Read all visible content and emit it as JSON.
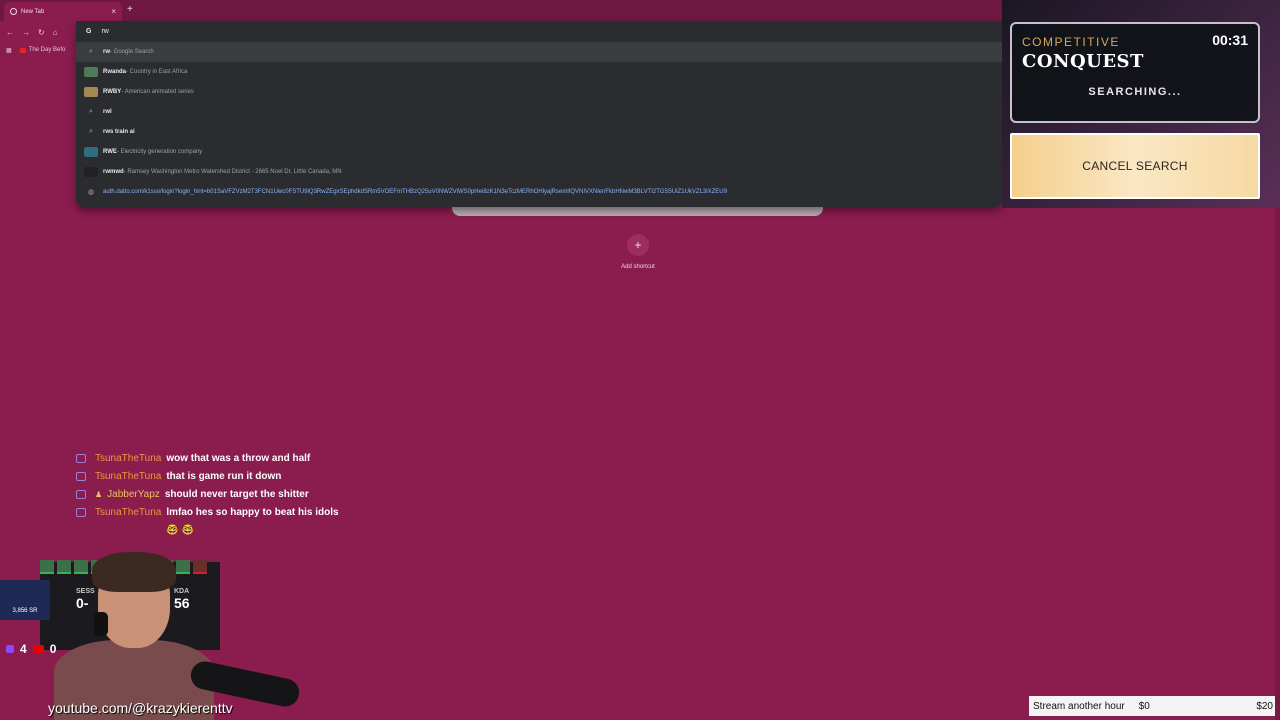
{
  "browser": {
    "tab_title": "New Tab",
    "new_tab_symbol": "+",
    "close_symbol": "×",
    "bookmark_label": "The Day Befo"
  },
  "omnibox": {
    "query": "rw",
    "suggestions": [
      {
        "type": "search",
        "bold": "rw",
        "sub": " - Google Search",
        "selected": true
      },
      {
        "type": "entity",
        "bold": "Rwanda",
        "sub": " - Country in East Africa",
        "thumb": "#4f7a5a"
      },
      {
        "type": "entity",
        "bold": "RWBY",
        "sub": " - American animated series",
        "thumb": "#a58752"
      },
      {
        "type": "search",
        "bold": "rwl",
        "sub": ""
      },
      {
        "type": "search",
        "bold": "rws train ai",
        "sub": ""
      },
      {
        "type": "entity",
        "bold": "RWE",
        "sub": " - Electricity generation company",
        "thumb": "#2f6e7a"
      },
      {
        "type": "entity",
        "bold": "rwmwd",
        "sub": " - Ramsey Washington Metro Watershed District - 2665 Noel Dr, Little Canada, MN",
        "thumb": "#222"
      },
      {
        "type": "url",
        "bold": "",
        "sub": "auth.datto.com/k1sso/login?login_hint=b01SaVFZVzM2T3FCN1Uwc0FSTU9iQ3RwZEgxSEphdkdSRm5VOEFmTHBzQ25uV0NWZVlWS0pHei8zK1N3eTczMERhOHlyajRsemlIQVNIVXNlenFkbHNwM3BLVTI2TG5SUlZ1UkVZL3lXZEU9"
      }
    ]
  },
  "newtab": {
    "add_symbol": "+",
    "add_label": "Add shortcut"
  },
  "game": {
    "mode_type": "COMPETITIVE",
    "mode_name": "CONQUEST",
    "timer": "00:31",
    "status": "SEARCHING...",
    "cancel_label": "CANCEL SEARCH"
  },
  "chat": [
    {
      "user": "TsunaTheTuna",
      "message": "wow that was a throw and half",
      "alt": false
    },
    {
      "user": "TsunaTheTuna",
      "message": "that is game run it down",
      "alt": false
    },
    {
      "user": "JabberYapz",
      "message": "should never target the shitter",
      "alt": true
    },
    {
      "user": "TsunaTheTuna",
      "message": "lmfao hes so happy to beat his idols 🤓 🤓",
      "alt": false
    }
  ],
  "stream": {
    "sr": "3,856 SR",
    "session_label": "SESS",
    "session_value": "0-",
    "kda_label": "KDA",
    "kda_value": "56",
    "twitch_viewers": "4",
    "youtube_viewers": "0",
    "handle": "youtube.com/@krazykierenttv"
  },
  "goal": {
    "label": "Stream another hour",
    "current": "$0",
    "target": "$20"
  },
  "colors": {
    "page_bg": "#8a1c4e",
    "omnibox_bg": "#2b2c30",
    "cancel_button": "#f6d9a3",
    "chat_user": "#e89a3c"
  }
}
